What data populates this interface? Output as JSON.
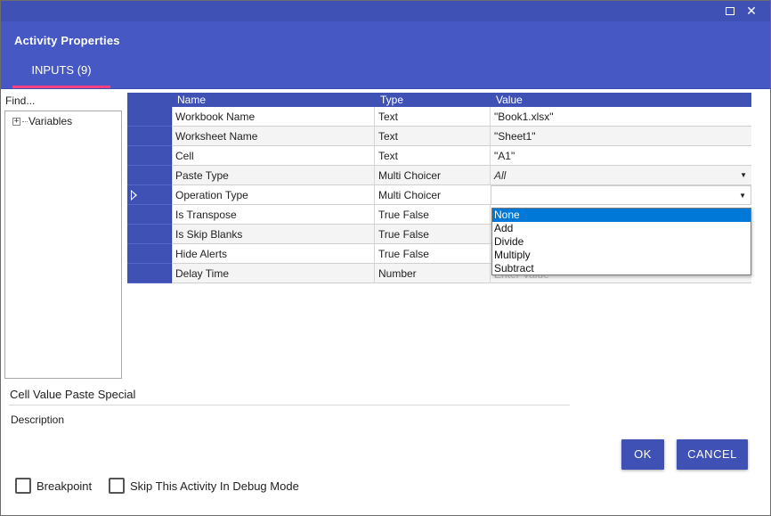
{
  "window": {
    "maximize_icon": "maximize-icon",
    "close_icon": "close-icon",
    "close_glyph": "✕"
  },
  "header": {
    "title": "Activity Properties",
    "tab_label": "INPUTS (9)"
  },
  "sidebar": {
    "find_label": "Find...",
    "tree_root": "Variables",
    "expander_glyph": "+"
  },
  "grid": {
    "columns": [
      "Name",
      "Type",
      "Value"
    ],
    "rows": [
      {
        "name": "Workbook Name",
        "type": "Text",
        "value": "\"Book1.xlsx\""
      },
      {
        "name": "Worksheet Name",
        "type": "Text",
        "value": "\"Sheet1\""
      },
      {
        "name": "Cell",
        "type": "Text",
        "value": "\"A1\""
      },
      {
        "name": "Paste Type",
        "type": "Multi Choicer",
        "value": "All"
      },
      {
        "name": "Operation Type",
        "type": "Multi Choicer",
        "value": ""
      },
      {
        "name": "Is Transpose",
        "type": "True False",
        "value": ""
      },
      {
        "name": "Is Skip Blanks",
        "type": "True False",
        "value": ""
      },
      {
        "name": "Hide Alerts",
        "type": "True False",
        "value": ""
      },
      {
        "name": "Delay Time",
        "type": "Number",
        "value": "Enter Value"
      }
    ],
    "dropdown_glyph": "▼"
  },
  "dropdown": {
    "options": [
      "None",
      "Add",
      "Divide",
      "Multiply",
      "Subtract"
    ],
    "selected": "None"
  },
  "footer": {
    "activity_name": "Cell Value Paste Special",
    "description_label": "Description",
    "ok_label": "OK",
    "cancel_label": "CANCEL",
    "breakpoint_label": "Breakpoint",
    "skip_label": "Skip This Activity In Debug Mode"
  },
  "colors": {
    "primary": "#3f51b5",
    "accent": "#ff4081",
    "selection": "#0078d7"
  }
}
